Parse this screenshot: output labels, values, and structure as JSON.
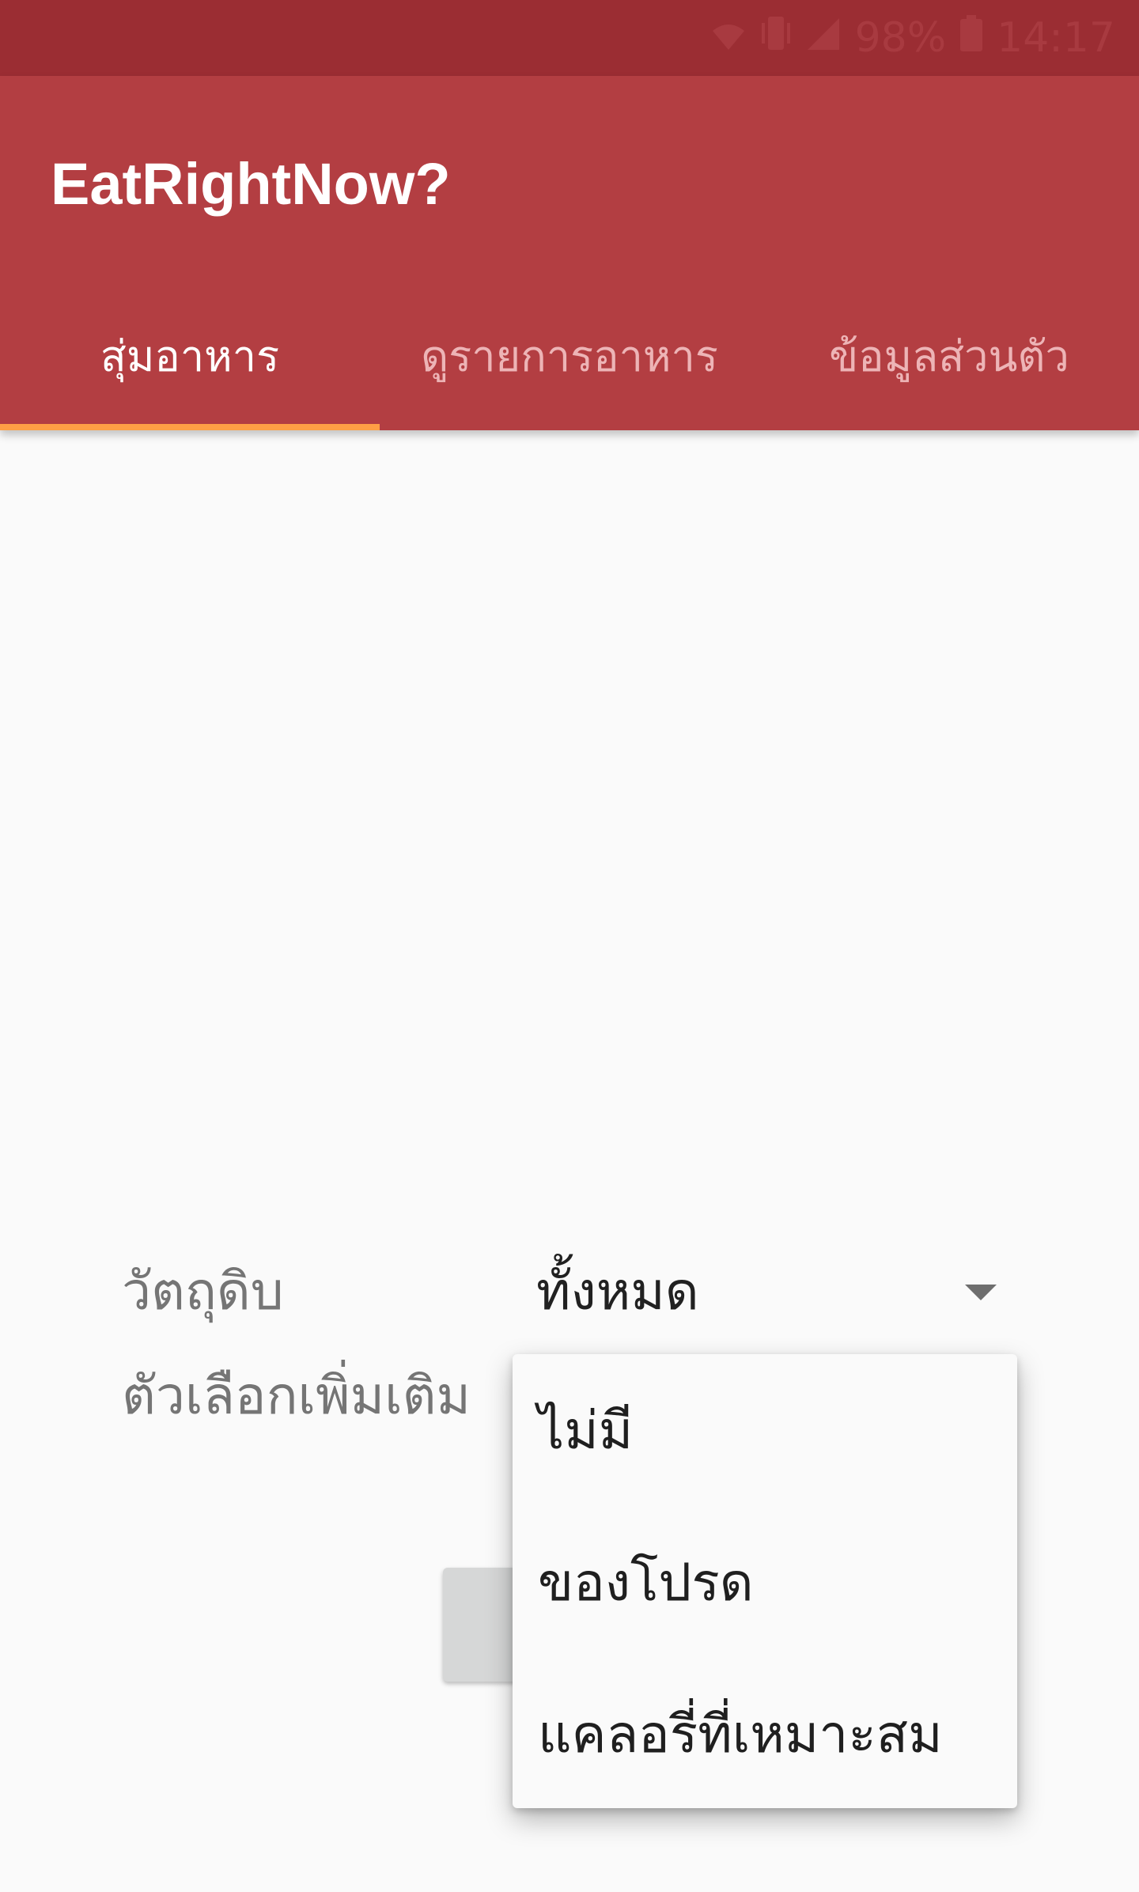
{
  "status_bar": {
    "icons": [
      "wifi-icon",
      "vibrate-icon",
      "signal-icon",
      "battery-icon"
    ],
    "battery_text": "98%",
    "time": "14:17"
  },
  "app_bar": {
    "title": "EatRightNow?",
    "tabs": [
      {
        "label": "สุ่มอาหาร",
        "selected": true
      },
      {
        "label": "ดูรายการอาหาร",
        "selected": false
      },
      {
        "label": "ข้อมูลส่วนตัว",
        "selected": false
      }
    ]
  },
  "form": {
    "ingredient_label": "วัตถุดิบ",
    "ingredient_value": "ทั้งหมด",
    "options_label": "ตัวเลือกเพิ่มเติม"
  },
  "dropdown": {
    "items": [
      {
        "label": "ไม่มี"
      },
      {
        "label": "ของโปรด"
      },
      {
        "label": "แคลอรี่ที่เหมาะสม"
      }
    ]
  },
  "colors": {
    "status_bar": "#9B2D33",
    "app_bar": "#B33E42",
    "tab_indicator": "#FF9F45",
    "background": "#FAFAFA"
  }
}
